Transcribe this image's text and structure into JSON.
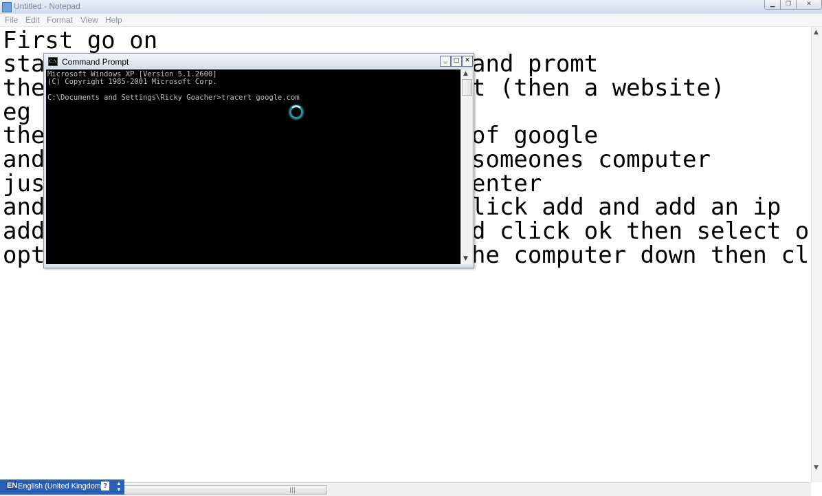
{
  "notepad": {
    "title": "Untitled - Notepad",
    "menu": [
      "File",
      "Edit",
      "Format",
      "View",
      "Help"
    ],
    "lines_left": [
      "First go on",
      "sta",
      "the",
      "eg",
      "the",
      "and",
      "jus",
      "and",
      "add",
      "opt"
    ],
    "lines_right": [
      "",
      "and promt",
      "t (then a website)",
      "",
      "of google",
      "someones computer",
      "enter",
      "lick add and add an ip",
      "d click ok then select o",
      "he computer down then cl"
    ]
  },
  "cmd": {
    "title": "Command Prompt",
    "icon_label": "C:\\",
    "lines": [
      "Microsoft Windows XP [Version 5.1.2600]",
      "(C) Copyright 1985-2001 Microsoft Corp.",
      "",
      "C:\\Documents and Settings\\Ricky Goacher>tracert google.com"
    ]
  },
  "langbar": {
    "code": "EN",
    "name": "English (United Kingdom)",
    "help": "?"
  },
  "icons": {
    "notepad_app": "notepad-icon",
    "cmd_app": "cmd-icon",
    "minimize": "minimize-icon",
    "maximize": "maximize-icon",
    "close": "close-icon",
    "busy": "busy-spinner-icon"
  }
}
